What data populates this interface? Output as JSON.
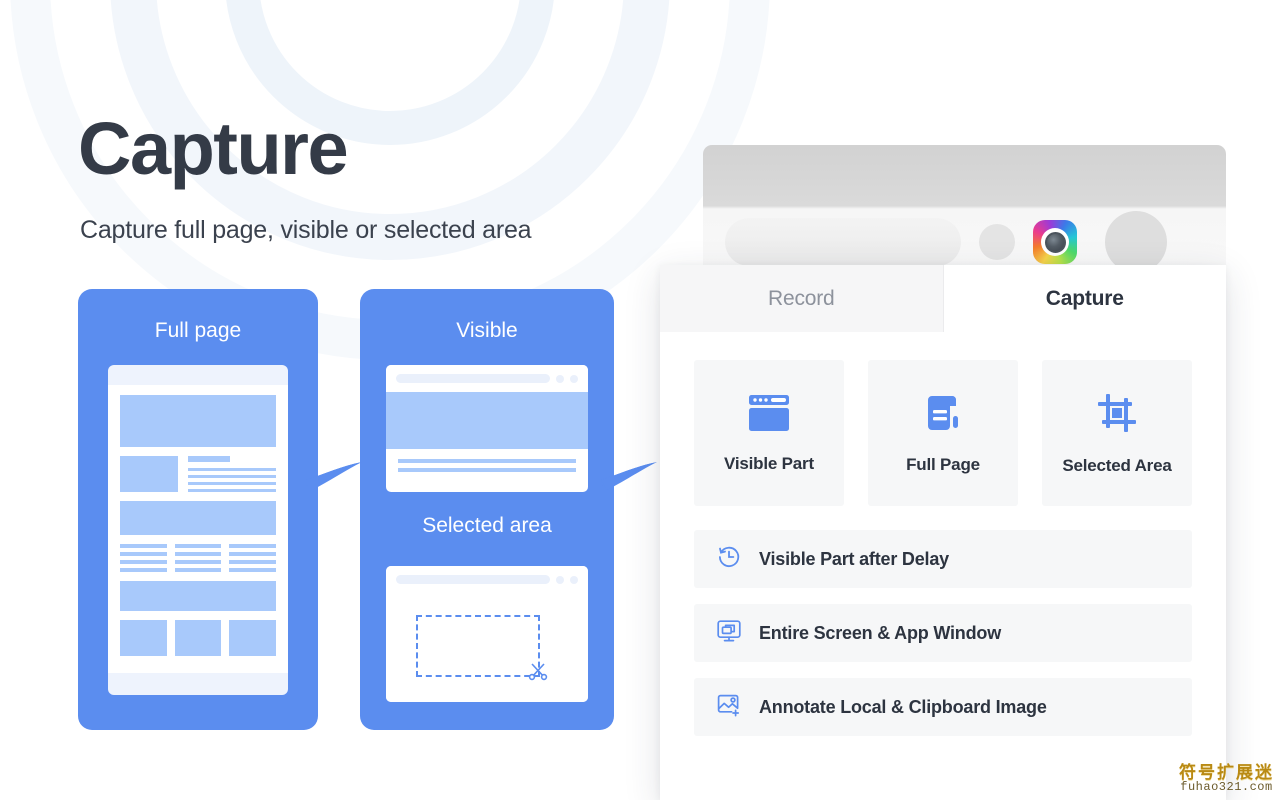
{
  "hero": {
    "title": "Capture",
    "subtitle": "Capture full page, visible or selected area"
  },
  "cards": {
    "full_page": {
      "title": "Full page"
    },
    "visible": {
      "title": "Visible",
      "selected_title": "Selected area"
    }
  },
  "browser": {
    "extension_icon_name": "camera-extension-icon"
  },
  "popup": {
    "tabs": [
      {
        "label": "Record",
        "active": false
      },
      {
        "label": "Capture",
        "active": true
      }
    ],
    "tiles": [
      {
        "label": "Visible Part",
        "icon": "browser-window-icon"
      },
      {
        "label": "Full Page",
        "icon": "scroll-document-icon"
      },
      {
        "label": "Selected Area",
        "icon": "crop-frame-icon"
      }
    ],
    "rows": [
      {
        "label": "Visible Part after Delay",
        "icon": "clock-delay-icon"
      },
      {
        "label": "Entire Screen & App Window",
        "icon": "monitor-windows-icon"
      },
      {
        "label": "Annotate Local & Clipboard Image",
        "icon": "image-plus-icon"
      }
    ]
  },
  "watermark": {
    "chinese": "符号扩展迷",
    "domain": "fuhao321.com"
  },
  "colors": {
    "accent_blue": "#5b8def",
    "light_blue": "#a8c9fb",
    "text_dark": "#2d3440",
    "panel_gray": "#f6f7f8"
  }
}
